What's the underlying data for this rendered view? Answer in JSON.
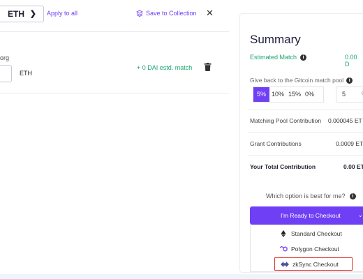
{
  "header": {
    "currency": "ETH",
    "apply_all": "Apply to all",
    "save_collection": "Save to Collection",
    "close": "✕"
  },
  "grant": {
    "name_fragment": "org",
    "token": "ETH",
    "match_text": "+ 0 DAI estd. match"
  },
  "summary": {
    "title": "Summary",
    "estimated_match_label": "Estimated Match",
    "estimated_match_value": "0.00 D",
    "give_back_label": "Give back to the Gitcoin match pool",
    "pcts": [
      "5%",
      "10%",
      "15%",
      "0%"
    ],
    "selected_pct": "5%",
    "custom_value": "5",
    "custom_unit": "%",
    "rows": [
      {
        "label": "Matching Pool Contribution",
        "value": "0.000045 ET"
      },
      {
        "label": "Grant Contributions",
        "value": "0.0009 ET"
      },
      {
        "label": "Your Total Contribution",
        "value": "0.00 ET"
      }
    ],
    "which_option": "Which option is best for me?",
    "checkout_label": "I'm Ready to Checkout",
    "options": [
      "Standard Checkout",
      "Polygon Checkout",
      "zkSync Checkout"
    ],
    "highlighted_option": "zkSync Checkout"
  },
  "colors": {
    "accent": "#6f3ff5",
    "success": "#1ca671",
    "highlight": "#e0302a"
  }
}
